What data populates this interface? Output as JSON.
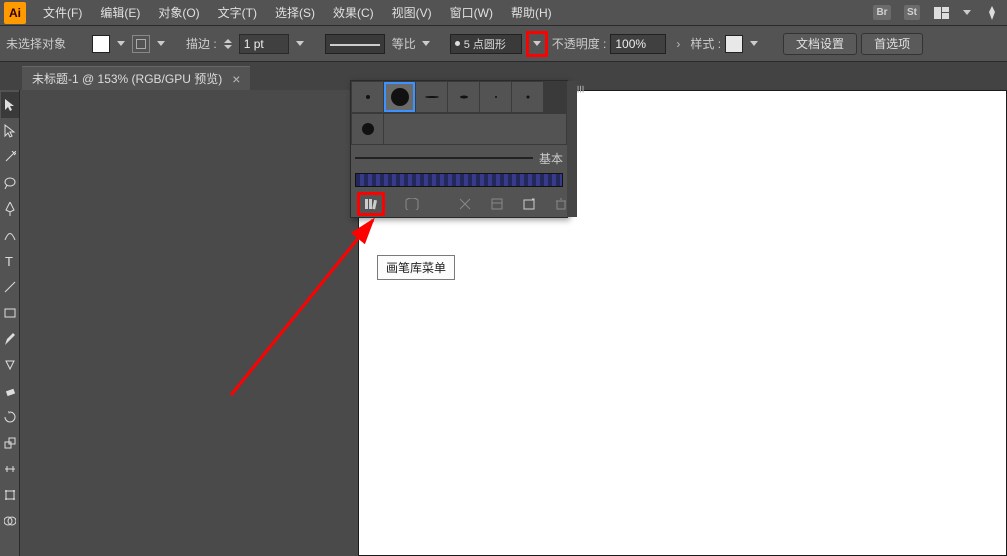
{
  "app": {
    "logo_text": "Ai"
  },
  "menu": {
    "items": [
      "文件(F)",
      "编辑(E)",
      "对象(O)",
      "文字(T)",
      "选择(S)",
      "效果(C)",
      "视图(V)",
      "窗口(W)",
      "帮助(H)"
    ],
    "badges": [
      "Br",
      "St"
    ]
  },
  "controlbar": {
    "selection_label": "未选择对象",
    "stroke_label": "描边 :",
    "stroke_value": "1 pt",
    "profile_label": "等比",
    "brush_preview": "5 点圆形",
    "opacity_label": "不透明度 :",
    "opacity_value": "100%",
    "style_label": "样式 :",
    "doc_setup_btn": "文档设置",
    "prefs_btn": "首选项"
  },
  "tab": {
    "title": "未标题-1 @ 153% (RGB/GPU 预览)",
    "close": "×"
  },
  "brush_panel": {
    "basic_label": "基本"
  },
  "tooltip": {
    "text": "画笔库菜单"
  }
}
